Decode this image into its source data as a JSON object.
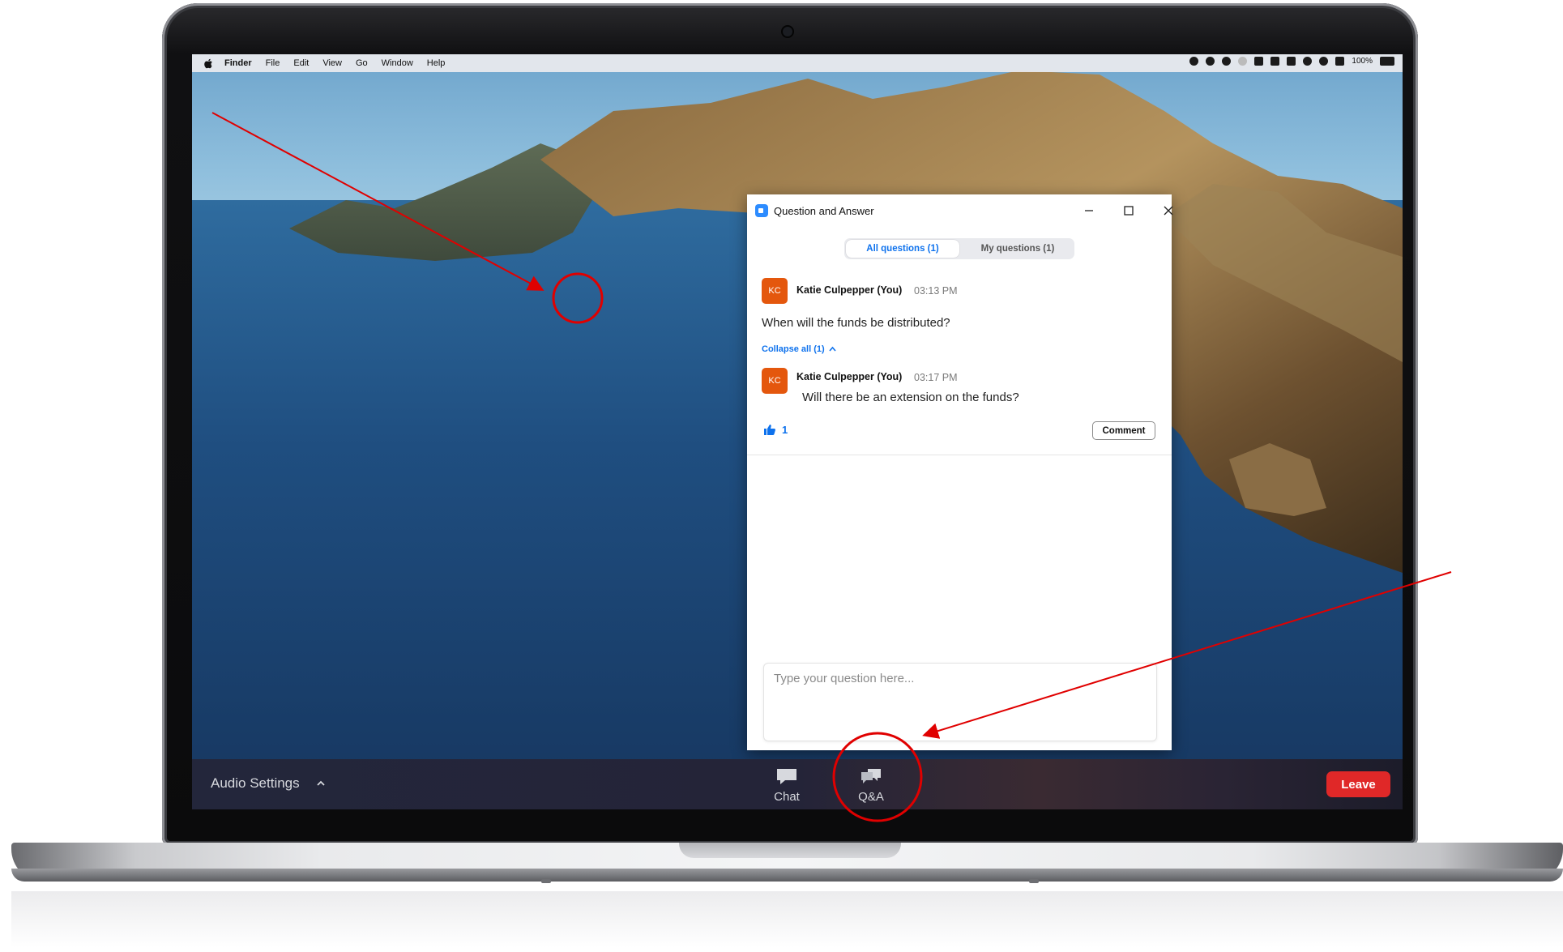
{
  "menubar": {
    "app": "Finder",
    "items": [
      "File",
      "Edit",
      "View",
      "Go",
      "Window",
      "Help"
    ],
    "battery": "100%"
  },
  "qa_window": {
    "title": "Question and Answer",
    "tabs": [
      {
        "label": "All questions (1)",
        "active": true
      },
      {
        "label": "My questions (1)",
        "active": false
      }
    ],
    "question": {
      "initials": "KC",
      "author": "Katie Culpepper (You)",
      "time": "03:13 PM",
      "text": "When will the funds be distributed?"
    },
    "collapse_label": "Collapse all (1)",
    "reply": {
      "initials": "KC",
      "author": "Katie Culpepper (You)",
      "time": "03:17 PM",
      "text": "Will there be an extension on the funds?"
    },
    "like_count": "1",
    "comment_label": "Comment",
    "input_placeholder": "Type your question here..."
  },
  "toolbar": {
    "audio_settings": "Audio Settings",
    "chat": "Chat",
    "qa": "Q&A",
    "leave": "Leave"
  },
  "colors": {
    "accent": "#0e72ed",
    "avatar": "#e4570d",
    "leave": "#e02828",
    "annotation": "#e00000"
  }
}
